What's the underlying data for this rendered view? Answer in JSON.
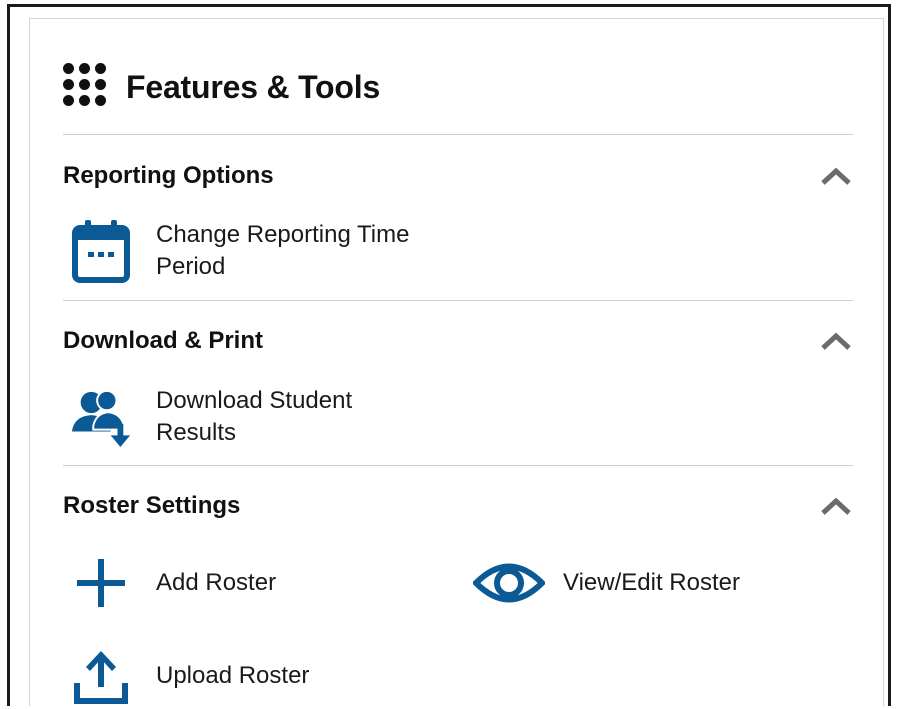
{
  "panel": {
    "title": "Features & Tools",
    "title_icon": "dots-grid-icon"
  },
  "accent_color": "#0b5a96",
  "sections": [
    {
      "title": "Reporting Options",
      "expanded": true,
      "items": [
        {
          "label": "Change Reporting Time\nPeriod",
          "icon": "calendar-icon"
        }
      ]
    },
    {
      "title": "Download & Print",
      "expanded": true,
      "items": [
        {
          "label": "Download Student\nResults",
          "icon": "users-download-icon"
        }
      ]
    },
    {
      "title": "Roster Settings",
      "expanded": true,
      "items": [
        {
          "label": "Add Roster",
          "icon": "plus-icon"
        },
        {
          "label": "View/Edit Roster",
          "icon": "eye-icon"
        },
        {
          "label": "Upload Roster",
          "icon": "upload-icon"
        }
      ]
    }
  ]
}
